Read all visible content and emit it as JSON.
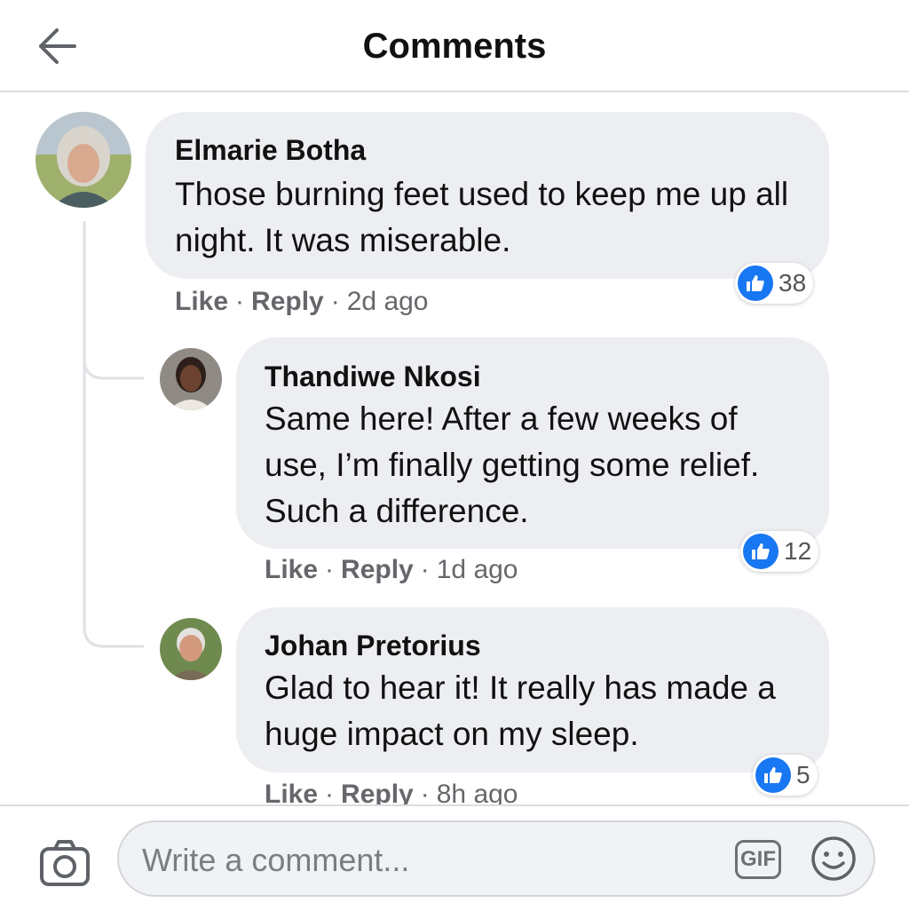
{
  "header": {
    "title": "Comments",
    "back_icon": "arrow-left-icon"
  },
  "comments": [
    {
      "author": "Elmarie Botha",
      "text": "Those burning feet used to keep me up all night. It was miserable.",
      "likes": "38",
      "like_label": "Like",
      "reply_label": "Reply",
      "time": "2d ago"
    },
    {
      "author": "Thandiwe Nkosi",
      "text": "Same here! After a few weeks of use, I’m finally getting some relief. Such a difference.",
      "likes": "12",
      "like_label": "Like",
      "reply_label": "Reply",
      "time": "1d ago"
    },
    {
      "author": "Johan Pretorius",
      "text": "Glad to hear it! It really has made a huge impact on my sleep.",
      "likes": "5",
      "like_label": "Like",
      "reply_label": "Reply",
      "time": "8h ago"
    }
  ],
  "composer": {
    "placeholder": "Write a comment...",
    "value": "",
    "gif_label": "GIF",
    "camera_icon": "camera-icon",
    "emoji_icon": "smiley-icon"
  },
  "colors": {
    "accent": "#1877f2",
    "bubble": "#eceef1",
    "muted_text": "#65676b"
  }
}
